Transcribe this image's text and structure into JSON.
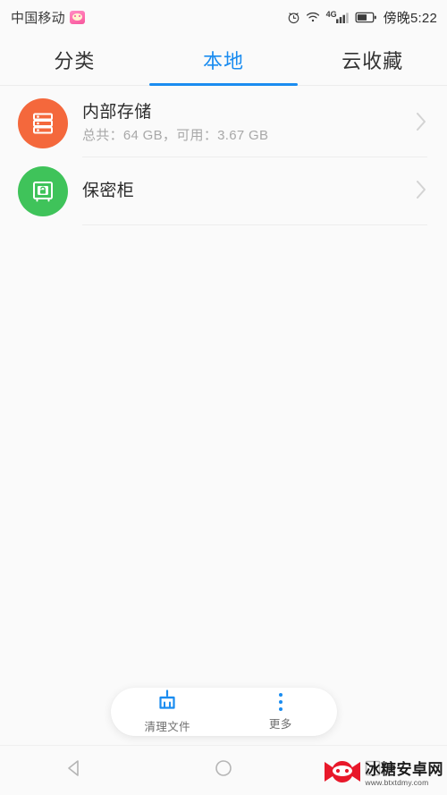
{
  "status_bar": {
    "carrier": "中国移动",
    "carrier_badge_icon": "pink-app-badge-icon",
    "alarm_icon": "alarm-clock-icon",
    "wifi_icon": "wifi-icon",
    "network_type": "4G",
    "signal_icon": "signal-bars-icon",
    "battery_icon": "battery-icon",
    "time": "傍晚5:22"
  },
  "tabs": [
    {
      "label": "分类",
      "active": false
    },
    {
      "label": "本地",
      "active": true
    },
    {
      "label": "云收藏",
      "active": false
    }
  ],
  "list": [
    {
      "title": "内部存储",
      "subtitle": "总共：64 GB，可用：3.67 GB",
      "icon": "internal-storage-icon",
      "icon_color": "#f4683c",
      "chevron": "chevron-right-icon"
    },
    {
      "title": "保密柜",
      "subtitle": "",
      "icon": "safe-vault-lock-icon",
      "icon_color": "#3fc35a",
      "chevron": "chevron-right-icon"
    }
  ],
  "bottom_bar": {
    "actions": [
      {
        "label": "清理文件",
        "icon": "broom-clean-icon"
      },
      {
        "label": "更多",
        "icon": "more-vertical-dots-icon"
      }
    ]
  },
  "nav_bar": {
    "back": "back-triangle-icon",
    "home": "home-circle-icon",
    "recents": "recents-square-icon"
  },
  "watermark": {
    "logo_icon": "ninja-mascot-logo-icon",
    "title": "冰糖安卓网",
    "url": "www.btxtdmy.com"
  },
  "colors": {
    "accent": "#1a8cf0",
    "storage_orange": "#f4683c",
    "vault_green": "#3fc35a",
    "page_bg": "#fafafa",
    "watermark_red": "#e8182a"
  }
}
